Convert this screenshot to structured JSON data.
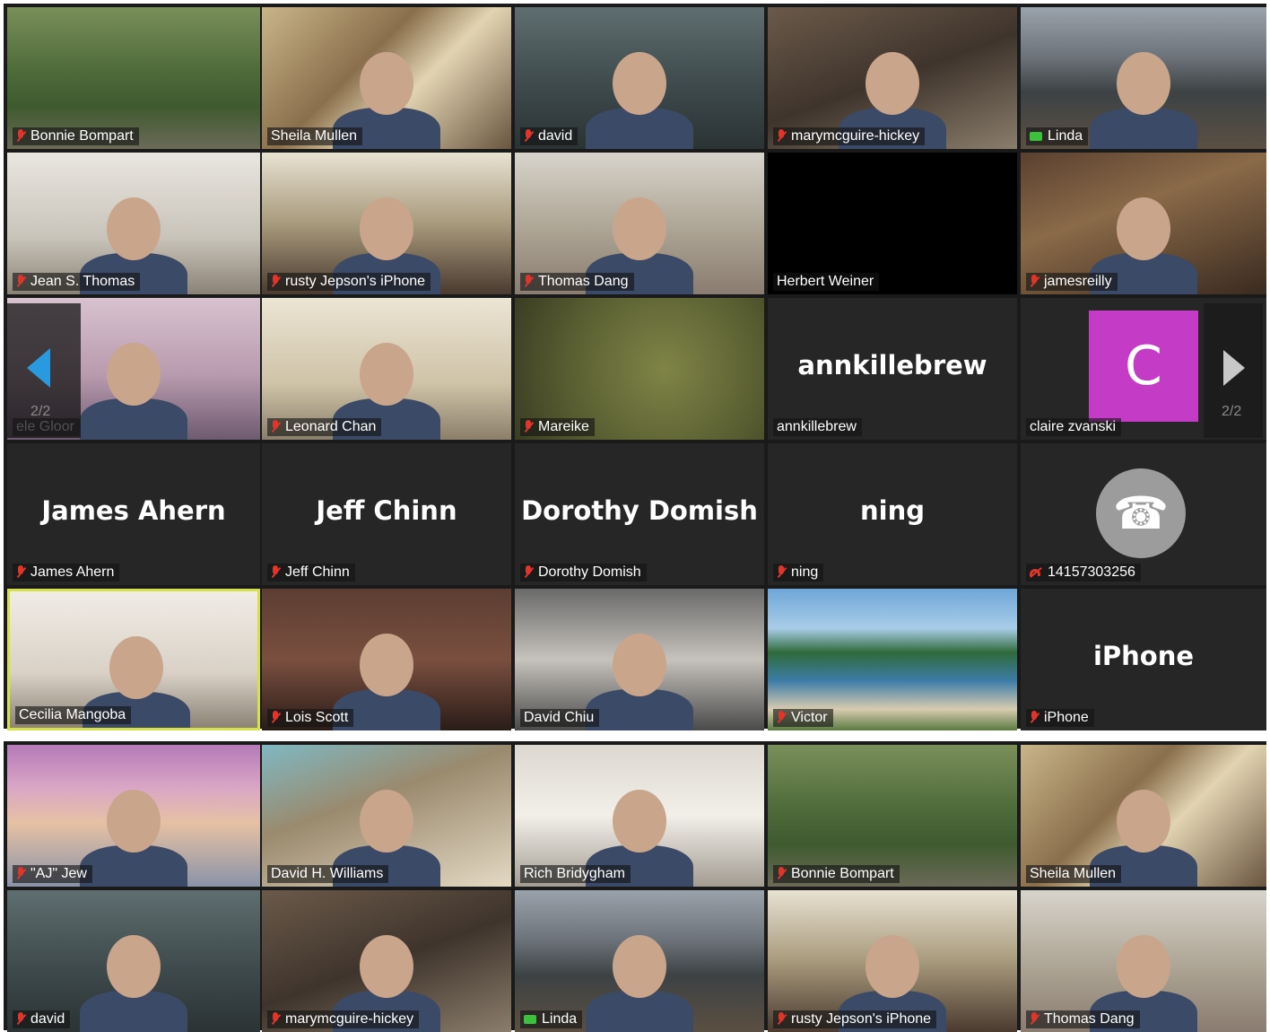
{
  "top_gallery": {
    "page_indicator": "2/2",
    "rows": [
      [
        {
          "name": "Bonnie Bompart",
          "muted": true,
          "scene": "birds"
        },
        {
          "name": "Sheila Mullen",
          "muted": false,
          "scene": "living"
        },
        {
          "name": "david",
          "muted": true,
          "scene": "ceiling"
        },
        {
          "name": "marymcguire-hickey",
          "muted": true,
          "scene": "room"
        },
        {
          "name": "Linda",
          "muted": false,
          "video_icon": true,
          "scene": "mountain"
        }
      ],
      [
        {
          "name": "Jean S. Thomas",
          "muted": true,
          "scene": "white"
        },
        {
          "name": "rusty Jepson's iPhone",
          "muted": true,
          "scene": "window"
        },
        {
          "name": "Thomas Dang",
          "muted": true,
          "scene": "face"
        },
        {
          "name": "Herbert Weiner",
          "muted": false,
          "scene": "black"
        },
        {
          "name": "jamesreilly",
          "muted": true,
          "scene": "books"
        }
      ],
      [
        {
          "name": "ele Gloor",
          "muted": false,
          "scene": "pink"
        },
        {
          "name": "Leonard Chan",
          "muted": true,
          "scene": "hall"
        },
        {
          "name": "Mareike",
          "muted": true,
          "scene": "blur"
        },
        {
          "name": "annkillebrew",
          "muted": false,
          "scene": "none",
          "display_name": "annkillebrew"
        },
        {
          "name": "claire zvanski",
          "muted": false,
          "scene": "none",
          "avatar_letter": "C"
        }
      ],
      [
        {
          "name": "James Ahern",
          "muted": true,
          "scene": "none",
          "display_name": "James Ahern"
        },
        {
          "name": "Jeff Chinn",
          "muted": true,
          "scene": "none",
          "display_name": "Jeff Chinn"
        },
        {
          "name": "Dorothy Domish",
          "muted": true,
          "scene": "none",
          "display_name": "Dorothy Domish"
        },
        {
          "name": "ning",
          "muted": true,
          "scene": "none",
          "display_name": "ning"
        },
        {
          "name": "14157303256",
          "muted": false,
          "phone_muted": true,
          "scene": "none",
          "phone_avatar": true
        }
      ],
      [
        {
          "name": "Cecilia Mangoba",
          "muted": false,
          "scene": "office",
          "active_speaker": true
        },
        {
          "name": "Lois Scott",
          "muted": true,
          "scene": "group"
        },
        {
          "name": "David Chiu",
          "muted": false,
          "scene": "car"
        },
        {
          "name": "Victor",
          "muted": true,
          "scene": "beach"
        },
        {
          "name": "iPhone",
          "muted": true,
          "scene": "none",
          "display_name": "iPhone"
        }
      ]
    ]
  },
  "bottom_gallery": {
    "rows": [
      [
        {
          "name": "\"AJ\" Jew",
          "muted": true,
          "scene": "bridge"
        },
        {
          "name": "David H. Williams",
          "muted": false,
          "scene": "studio",
          "talking": true
        },
        {
          "name": "Rich Bridygham",
          "muted": false,
          "scene": "plain"
        },
        {
          "name": "Bonnie Bompart",
          "muted": true,
          "scene": "birds"
        },
        {
          "name": "Sheila Mullen",
          "muted": false,
          "scene": "living"
        }
      ],
      [
        {
          "name": "david",
          "muted": true,
          "scene": "ceiling"
        },
        {
          "name": "marymcguire-hickey",
          "muted": true,
          "scene": "room"
        },
        {
          "name": "Linda",
          "muted": false,
          "video_icon": true,
          "scene": "mountain"
        },
        {
          "name": "rusty Jepson's iPhone",
          "muted": true,
          "scene": "window"
        },
        {
          "name": "Thomas Dang",
          "muted": true,
          "scene": "face"
        }
      ]
    ]
  },
  "colors": {
    "panel_bg": "#1a1a1a",
    "tile_bg": "#262626",
    "muted_red": "#e0352b",
    "active_speaker_border": "#d6e04c",
    "avatar_purple": "#c43cc6",
    "nav_arrow_blue": "#2a9ae0"
  }
}
